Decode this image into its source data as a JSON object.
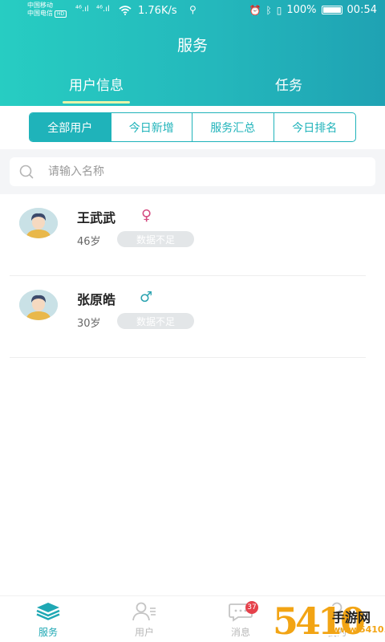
{
  "status_bar": {
    "carrier1": "中国移动",
    "carrier2": "中国电信",
    "hd": "HD",
    "net1": "⁴⁶.ıl",
    "net2": "⁴⁶.ıl",
    "wifi_icon": "wifi-icon",
    "speed": "1.76K/s",
    "battery": "100%",
    "time": "00:54"
  },
  "header": {
    "title": "服务",
    "tabs": [
      {
        "label": "用户信息",
        "active": true
      },
      {
        "label": "任务",
        "active": false
      }
    ]
  },
  "segments": [
    {
      "label": "全部用户",
      "active": true
    },
    {
      "label": "今日新增",
      "active": false
    },
    {
      "label": "服务汇总",
      "active": false
    },
    {
      "label": "今日排名",
      "active": false
    }
  ],
  "search": {
    "placeholder": "请输入名称",
    "value": ""
  },
  "users": [
    {
      "name": "王武武",
      "gender": "♀",
      "gender_type": "female",
      "age": "46岁",
      "status": "数据不足"
    },
    {
      "name": "张原皓",
      "gender": "♂",
      "gender_type": "male",
      "age": "30岁",
      "status": "数据不足"
    }
  ],
  "bottom_nav": [
    {
      "label": "服务",
      "icon": "layers-icon",
      "active": true
    },
    {
      "label": "用户",
      "icon": "user-list-icon",
      "active": false
    },
    {
      "label": "消息",
      "icon": "message-icon",
      "active": false,
      "badge": "37"
    },
    {
      "label": "我的",
      "icon": "profile-icon",
      "active": false
    }
  ],
  "watermark": {
    "digits": "5410",
    "text": "手游网",
    "url": "www.5410.cn"
  },
  "colors": {
    "primary": "#1fb3ba",
    "header_start": "#27cdc2",
    "header_end": "#1fa2b3",
    "female": "#d44a80",
    "male": "#2ba3b0",
    "badge": "#e5414b"
  }
}
